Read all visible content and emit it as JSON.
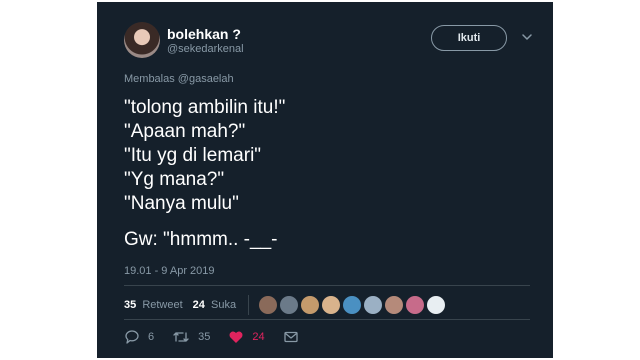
{
  "author": {
    "display_name": "bolehkan ?",
    "handle": "@sekedarkenal"
  },
  "follow_button": {
    "label": "Ikuti"
  },
  "reply_to": "Membalas @gasaelah",
  "tweet": {
    "lines": [
      "\"tolong ambilin itu!\"",
      "\"Apaan mah?\"",
      "\"Itu yg di lemari\"",
      "\"Yg mana?\"",
      "\"Nanya mulu\"",
      "",
      "Gw: \"hmmm.. -__-"
    ]
  },
  "timestamp": "19.01 - 9 Apr 2019",
  "stats": {
    "retweets_count": "35",
    "retweets_label": "Retweet",
    "likes_count": "24",
    "likes_label": "Suka"
  },
  "liker_avatars": [
    {
      "name": "liker-avatar-1",
      "color": "#8a6a5a"
    },
    {
      "name": "liker-avatar-2",
      "color": "#6b7a89"
    },
    {
      "name": "liker-avatar-3",
      "color": "#c49a6c"
    },
    {
      "name": "liker-avatar-4",
      "color": "#d9b38c"
    },
    {
      "name": "liker-avatar-5",
      "color": "#4a90c2"
    },
    {
      "name": "liker-avatar-6",
      "color": "#9bb0c4"
    },
    {
      "name": "liker-avatar-7",
      "color": "#b58a7a"
    },
    {
      "name": "liker-avatar-8",
      "color": "#c76b8a"
    },
    {
      "name": "liker-avatar-9",
      "color": "#e8eef2"
    }
  ],
  "actions": {
    "reply_count": "6",
    "retweet_count": "35",
    "like_count": "24"
  },
  "colors": {
    "background": "#15202b",
    "secondary_text": "#8899a6",
    "divider": "#38444d",
    "like_accent": "#e0245e"
  }
}
